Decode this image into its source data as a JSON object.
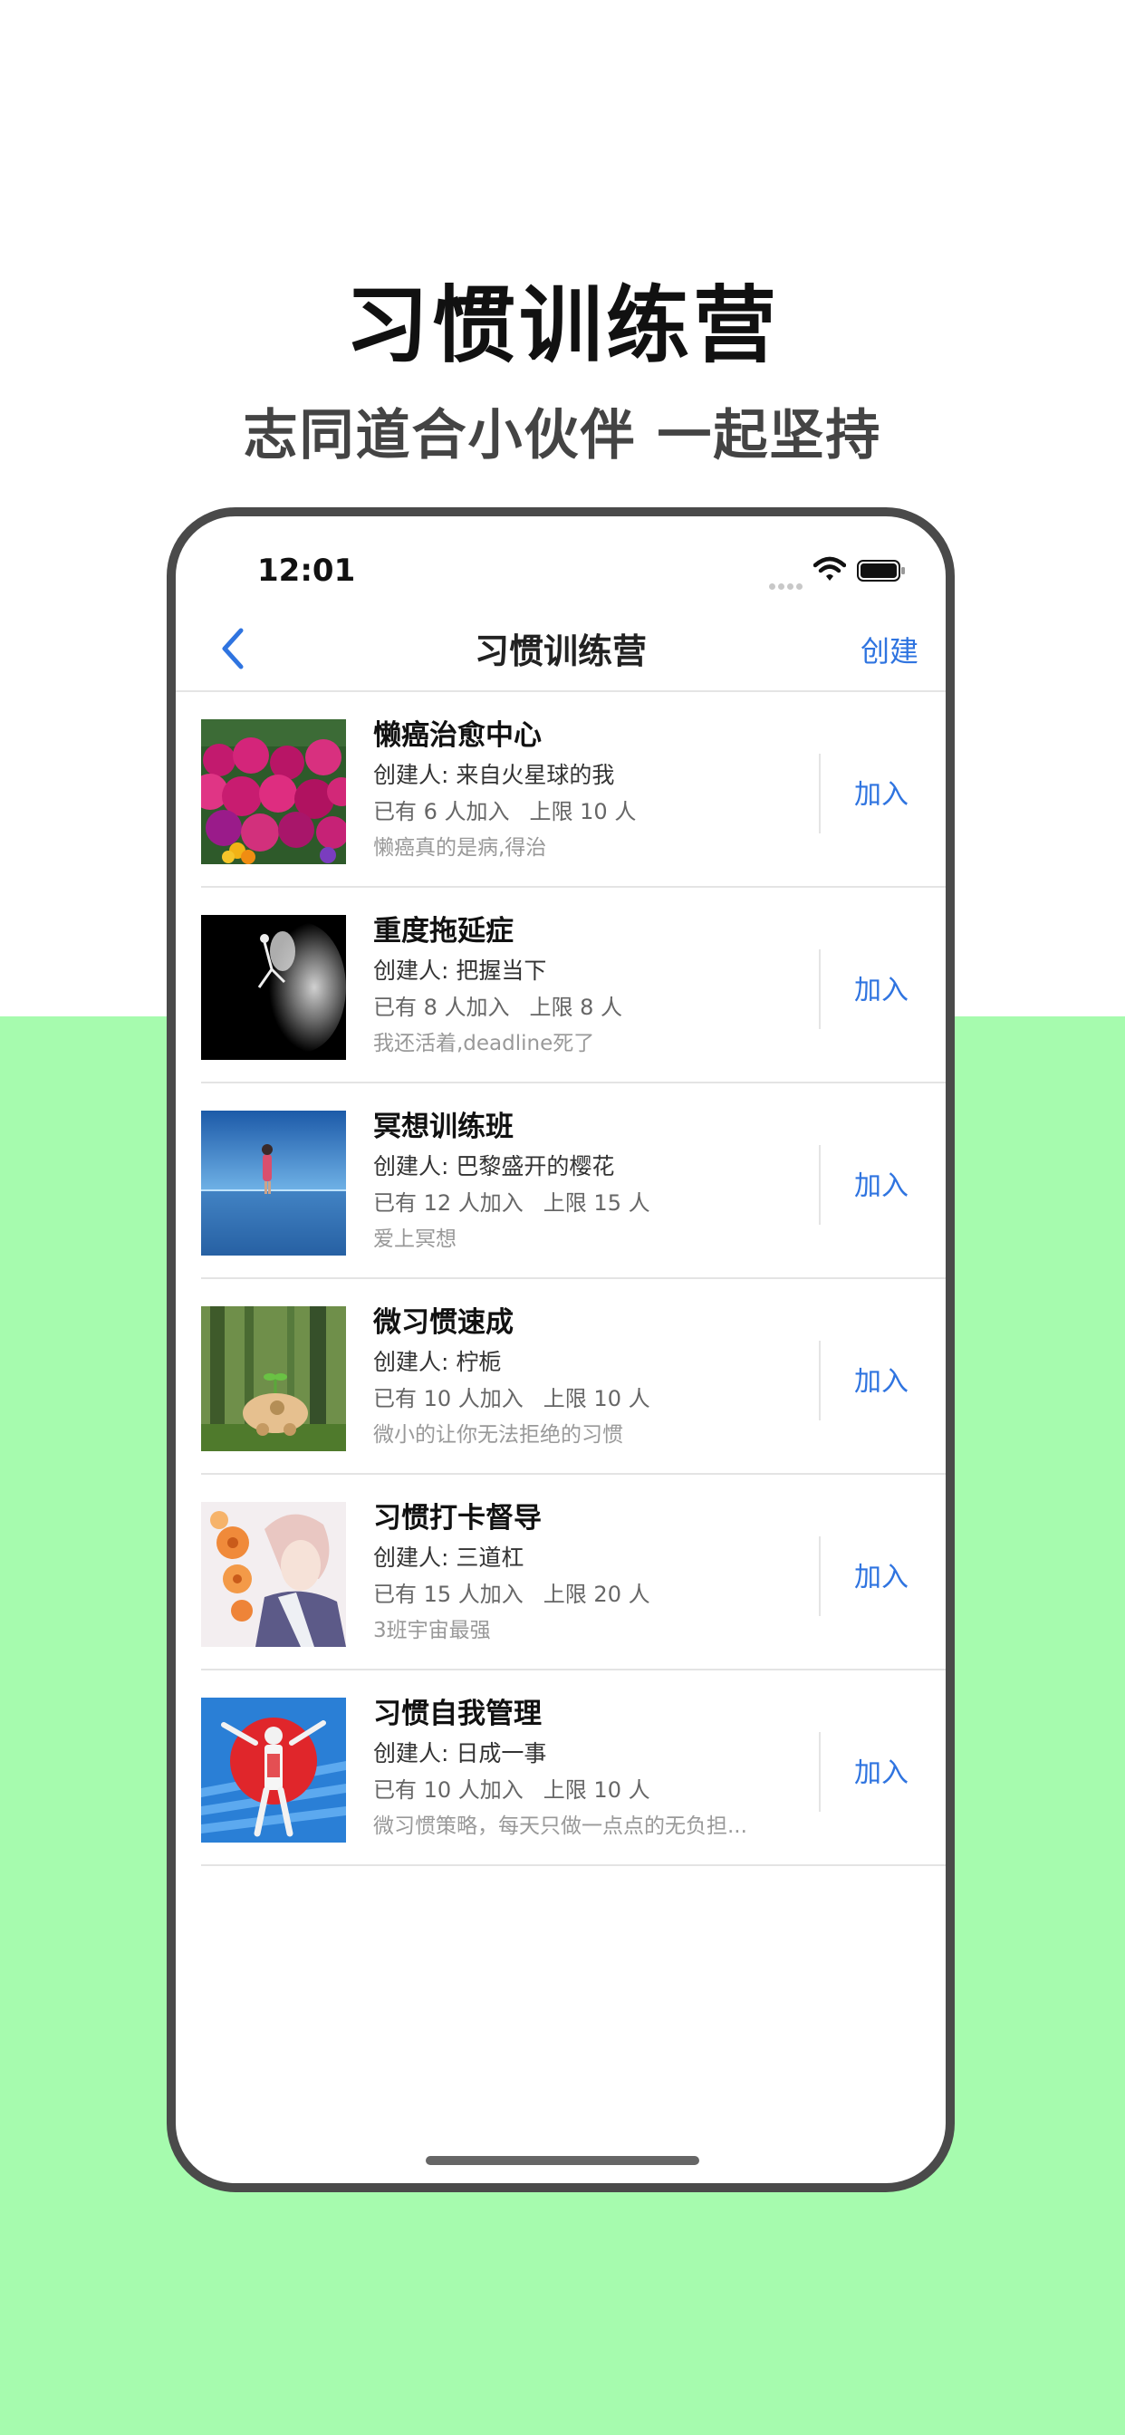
{
  "promo": {
    "headline": "习惯训练营",
    "subheadline": "志同道合小伙伴 一起坚持"
  },
  "status_bar": {
    "time": "12:01"
  },
  "nav": {
    "title": "习惯训练营",
    "create_label": "创建"
  },
  "camps": [
    {
      "name": "懒癌治愈中心",
      "creator": "创建人: 来自火星球的我",
      "joined": "已有 6 人加入",
      "limit": "上限 10 人",
      "description": "懒癌真的是病,得治",
      "join_label": "加入",
      "thumbnail": "flower-field"
    },
    {
      "name": "重度拖延症",
      "creator": "创建人: 把握当下",
      "joined": "已有 8 人加入",
      "limit": "上限 8 人",
      "description": "我还活着,deadline死了",
      "join_label": "加入",
      "thumbnail": "dancer-smoke"
    },
    {
      "name": "冥想训练班",
      "creator": "创建人: 巴黎盛开的樱花",
      "joined": "已有 12 人加入",
      "limit": "上限 15 人",
      "description": "爱上冥想",
      "join_label": "加入",
      "thumbnail": "person-on-water"
    },
    {
      "name": "微习惯速成",
      "creator": "创建人: 柠栀",
      "joined": "已有 10 人加入",
      "limit": "上限 10 人",
      "description": "微小的让你无法拒绝的习惯",
      "join_label": "加入",
      "thumbnail": "sprout-toy-forest"
    },
    {
      "name": "习惯打卡督导",
      "creator": "创建人: 三道杠",
      "joined": "已有 15 人加入",
      "limit": "上限 20 人",
      "description": "3班宇宙最强",
      "join_label": "加入",
      "thumbnail": "anime-flowers"
    },
    {
      "name": "习惯自我管理",
      "creator": "创建人: 日成一事",
      "joined": "已有 10 人加入",
      "limit": "上限 10 人",
      "description": "微习惯策略，每天只做一点点的无负担...",
      "join_label": "加入",
      "thumbnail": "glico-runner"
    }
  ],
  "colors": {
    "accent": "#2f74e0",
    "promo_background": "#a6fbae",
    "phone_frame": "#4a4a4a"
  }
}
